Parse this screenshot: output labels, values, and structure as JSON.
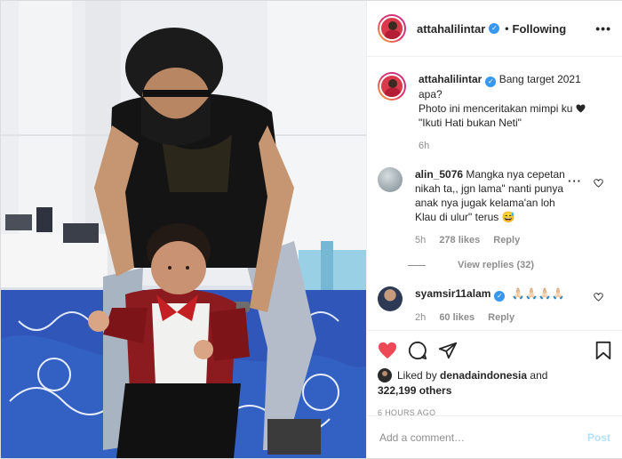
{
  "colors": {
    "accent": "#3897f0",
    "like_red": "#ed4956",
    "muted": "#8e8e8e",
    "post_disabled": "#b2dffc"
  },
  "header": {
    "username": "attahalilintar",
    "verified_icon": "verified-badge-icon",
    "separator": "•",
    "follow_status": "Following",
    "more_label": "•••"
  },
  "caption": {
    "username": "attahalilintar",
    "line1": "Bang target 2021",
    "line2": "apa?",
    "line3": "Photo ini menceritakan mimpi ku",
    "line3_icon": "black-heart-icon",
    "line4": "\"Ikuti Hati bukan Neti\"",
    "time": "6h"
  },
  "comments": [
    {
      "username": "alin_5076",
      "text_parts": [
        "Mangka nya cepetan",
        "nikah ta,, jgn lama\" nanti punya",
        "anak nya jugak kelama'an loh",
        "Klau di ulur\" terus 😅"
      ],
      "time": "5h",
      "likes": "278 likes",
      "reply": "Reply",
      "view_replies": "View replies (32)"
    },
    {
      "username": "syamsir11alam",
      "text": "🙏🏻🙏🏻🙏🏻🙏🏻",
      "time": "2h",
      "likes": "60 likes",
      "reply": "Reply"
    }
  ],
  "liked_by": {
    "prefix": "Liked by",
    "user": "denadaindonesia",
    "and": "and",
    "others": "322,199 others"
  },
  "posted_ago": "6 HOURS AGO",
  "add_comment": {
    "placeholder": "Add a comment…",
    "post_label": "Post"
  }
}
